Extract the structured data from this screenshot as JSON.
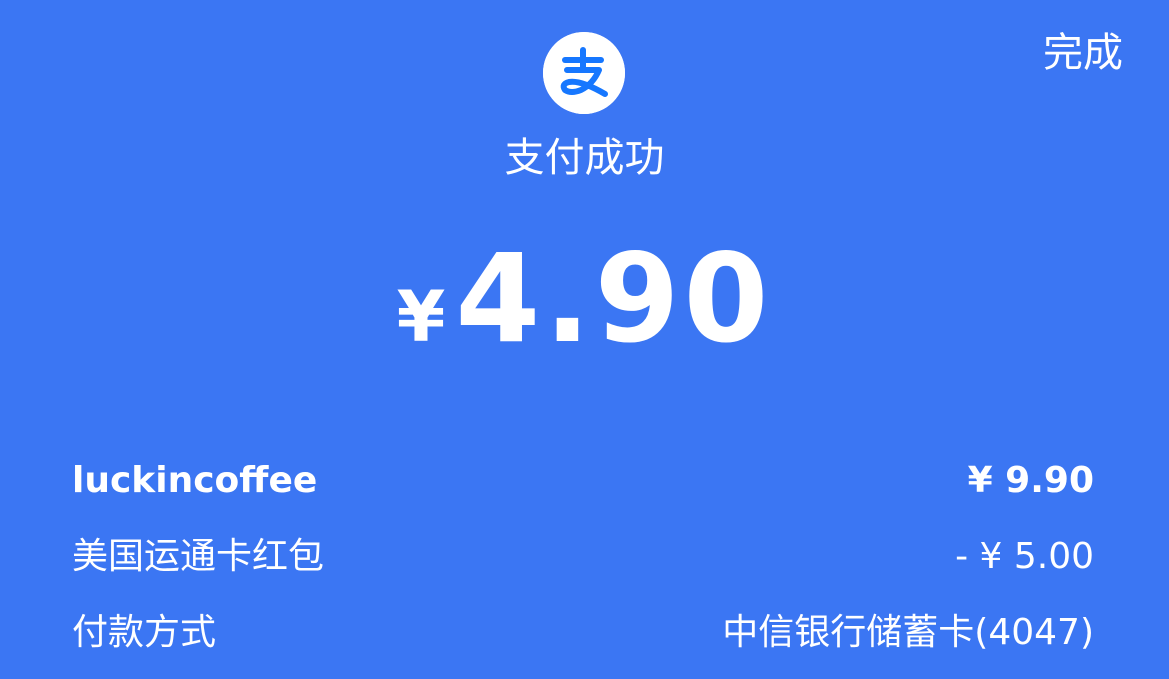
{
  "header": {
    "done_label": "完成"
  },
  "logo": {
    "icon": "alipay-logo-icon",
    "color": "#1677ff"
  },
  "status": {
    "title": "支付成功"
  },
  "amount": {
    "currency": "¥",
    "value": "4.90"
  },
  "details": [
    {
      "label": "luckincoffee",
      "value": "¥ 9.90"
    },
    {
      "label": "美国运通卡红包",
      "value": "- ¥ 5.00"
    },
    {
      "label": "付款方式",
      "value": "中信银行储蓄卡(4047)"
    }
  ],
  "colors": {
    "background": "#3b76f3",
    "text": "#ffffff"
  }
}
